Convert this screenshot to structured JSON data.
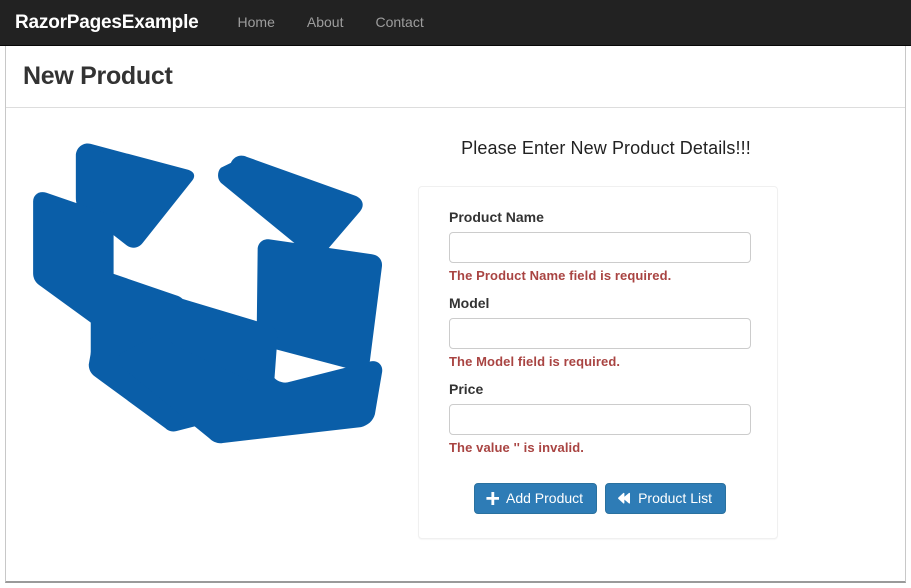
{
  "navbar": {
    "brand": "RazorPagesExample",
    "links": [
      {
        "label": "Home",
        "name": "nav-link-home"
      },
      {
        "label": "About",
        "name": "nav-link-about"
      },
      {
        "label": "Contact",
        "name": "nav-link-contact"
      }
    ]
  },
  "page": {
    "title": "New Product"
  },
  "illustration": {
    "icon": "open-box-icon",
    "color": "#0a5ea8"
  },
  "form": {
    "heading": "Please Enter New Product Details!!!",
    "fields": [
      {
        "label": "Product Name",
        "value": "",
        "placeholder": "",
        "error": "The Product Name field is required.",
        "input_name": "product-name-input",
        "label_name": "product-name-label",
        "error_name": "product-name-validation-error"
      },
      {
        "label": "Model",
        "value": "",
        "placeholder": "",
        "error": "The Model field is required.",
        "input_name": "model-input",
        "label_name": "model-label",
        "error_name": "model-validation-error"
      },
      {
        "label": "Price",
        "value": "",
        "placeholder": "",
        "error": "The value '' is invalid.",
        "input_name": "price-input",
        "label_name": "price-label",
        "error_name": "price-validation-error"
      }
    ],
    "buttons": {
      "submit": {
        "label": "Add Product",
        "icon": "plus-icon"
      },
      "list": {
        "label": "Product List",
        "icon": "fast-backward-icon"
      }
    }
  },
  "colors": {
    "navbar_background": "#222222",
    "nav_link": "#9d9d9d",
    "brand": "#ffffff",
    "button_primary": "#2e7cb6",
    "validation_error": "#a94442",
    "box_blue": "#0a5ea8",
    "input_border": "#cccccc"
  }
}
